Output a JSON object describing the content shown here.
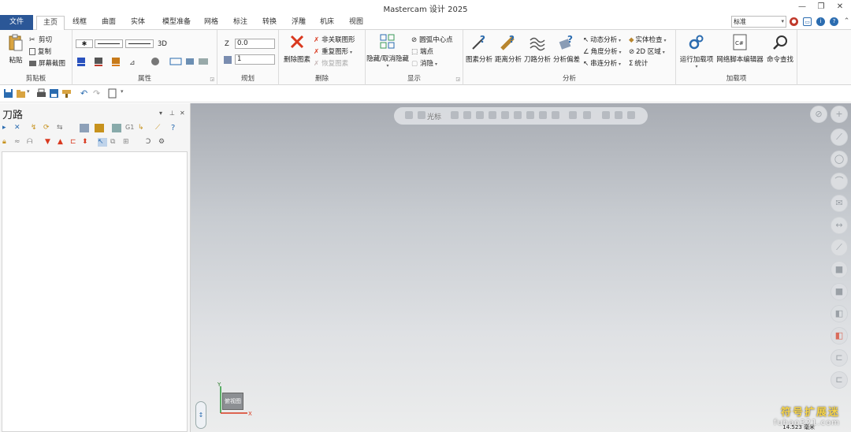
{
  "app": {
    "title": "Mastercam 设计 2025"
  },
  "tabs": [
    "文件",
    "主页",
    "线框",
    "曲面",
    "实体",
    "模型准备",
    "网格",
    "标注",
    "转换",
    "浮雕",
    "机床",
    "视图"
  ],
  "view_combo": {
    "value": "标准"
  },
  "ribbon": {
    "clipboard": {
      "label": "剪贴板",
      "paste": "粘贴",
      "cut": "剪切",
      "copy": "复制",
      "screenshot": "屏幕截图"
    },
    "attributes": {
      "label": "属性",
      "dim_3d": "3D"
    },
    "planning": {
      "label": "规划",
      "z_label": "Z",
      "z_value": "0.0",
      "level_value": "1"
    },
    "delete": {
      "label": "删除",
      "delete_entities": "删除图素",
      "nonassoc": "非关联图形",
      "duplicate": "重复图形",
      "restore": "恢复图素"
    },
    "display": {
      "label": "显示",
      "hide_unhide": "隐藏/取消隐藏",
      "arc_center": "圆弧中心点",
      "endpoints": "端点",
      "blank": "消隐"
    },
    "analyze": {
      "label": "分析",
      "entity": "图素分析",
      "distance": "距离分析",
      "toolpath": "刀路分析",
      "deviation": "分析偏差",
      "dynamic": "动态分析",
      "angle": "角度分析",
      "chain": "串连分析",
      "solid_check": "实体检查",
      "area_2d": "2D 区域",
      "stats": "统计"
    },
    "addins": {
      "label": "加载项",
      "run_addin": "运行加载项",
      "net_script": "网络脚本编辑器",
      "cmd_finder": "命令查找"
    }
  },
  "panel": {
    "title": "刀路"
  },
  "viewport": {
    "cursor_label": "光标",
    "gview_label": "俯视图",
    "axis_x": "X",
    "axis_y": "Y",
    "scale": "14.523 毫米"
  },
  "watermark": {
    "cn": "符号扩展迷",
    "en": "fuhao321.com"
  },
  "colors": {
    "file_tab": "#2b5797",
    "viewport_top": "#a8acb3",
    "viewport_bottom": "#eceded",
    "delete_red": "#c0392b"
  }
}
